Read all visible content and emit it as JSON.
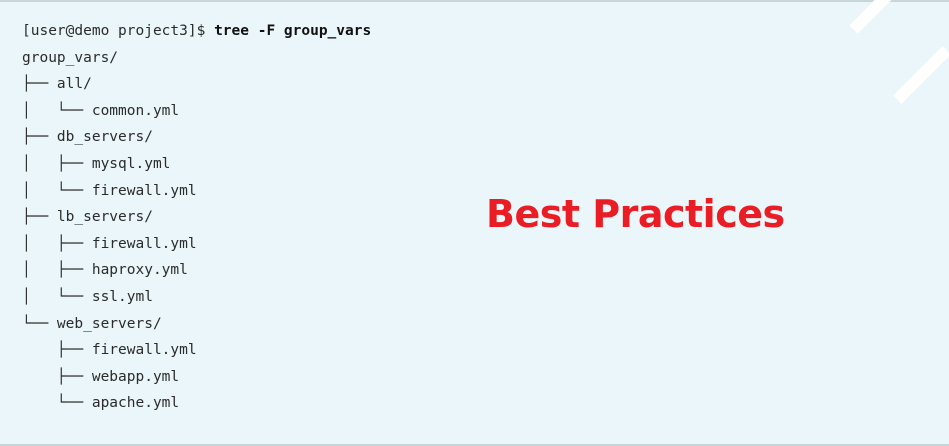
{
  "terminal": {
    "prompt": "[user@demo project3]$ ",
    "command": "tree -F group_vars",
    "lines": [
      "group_vars/",
      "├── all/",
      "│   └── common.yml",
      "├── db_servers/",
      "│   ├── mysql.yml",
      "│   └── firewall.yml",
      "├── lb_servers/",
      "│   ├── firewall.yml",
      "│   ├── haproxy.yml",
      "│   └── ssl.yml",
      "└── web_servers/",
      "    ├── firewall.yml",
      "    ├── webapp.yml",
      "    └── apache.yml"
    ]
  },
  "overlay": {
    "title": "Best Practices"
  },
  "colors": {
    "background": "#eaf6f9",
    "terminal_text": "#2b2b2b",
    "overlay_title": "#ea1c24"
  }
}
